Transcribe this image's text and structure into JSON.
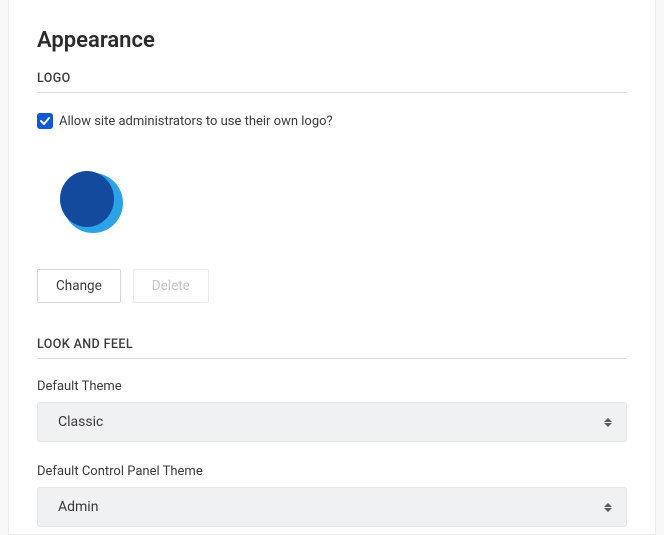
{
  "pageTitle": "Appearance",
  "sections": {
    "logo": {
      "heading": "LOGO",
      "allowAdminLogoLabel": "Allow site administrators to use their own logo?",
      "allowAdminLogoChecked": true,
      "changeButton": "Change",
      "deleteButton": "Delete"
    },
    "lookAndFeel": {
      "heading": "LOOK AND FEEL",
      "defaultThemeLabel": "Default Theme",
      "defaultThemeValue": "Classic",
      "controlPanelThemeLabel": "Default Control Panel Theme",
      "controlPanelThemeValue": "Admin"
    }
  }
}
